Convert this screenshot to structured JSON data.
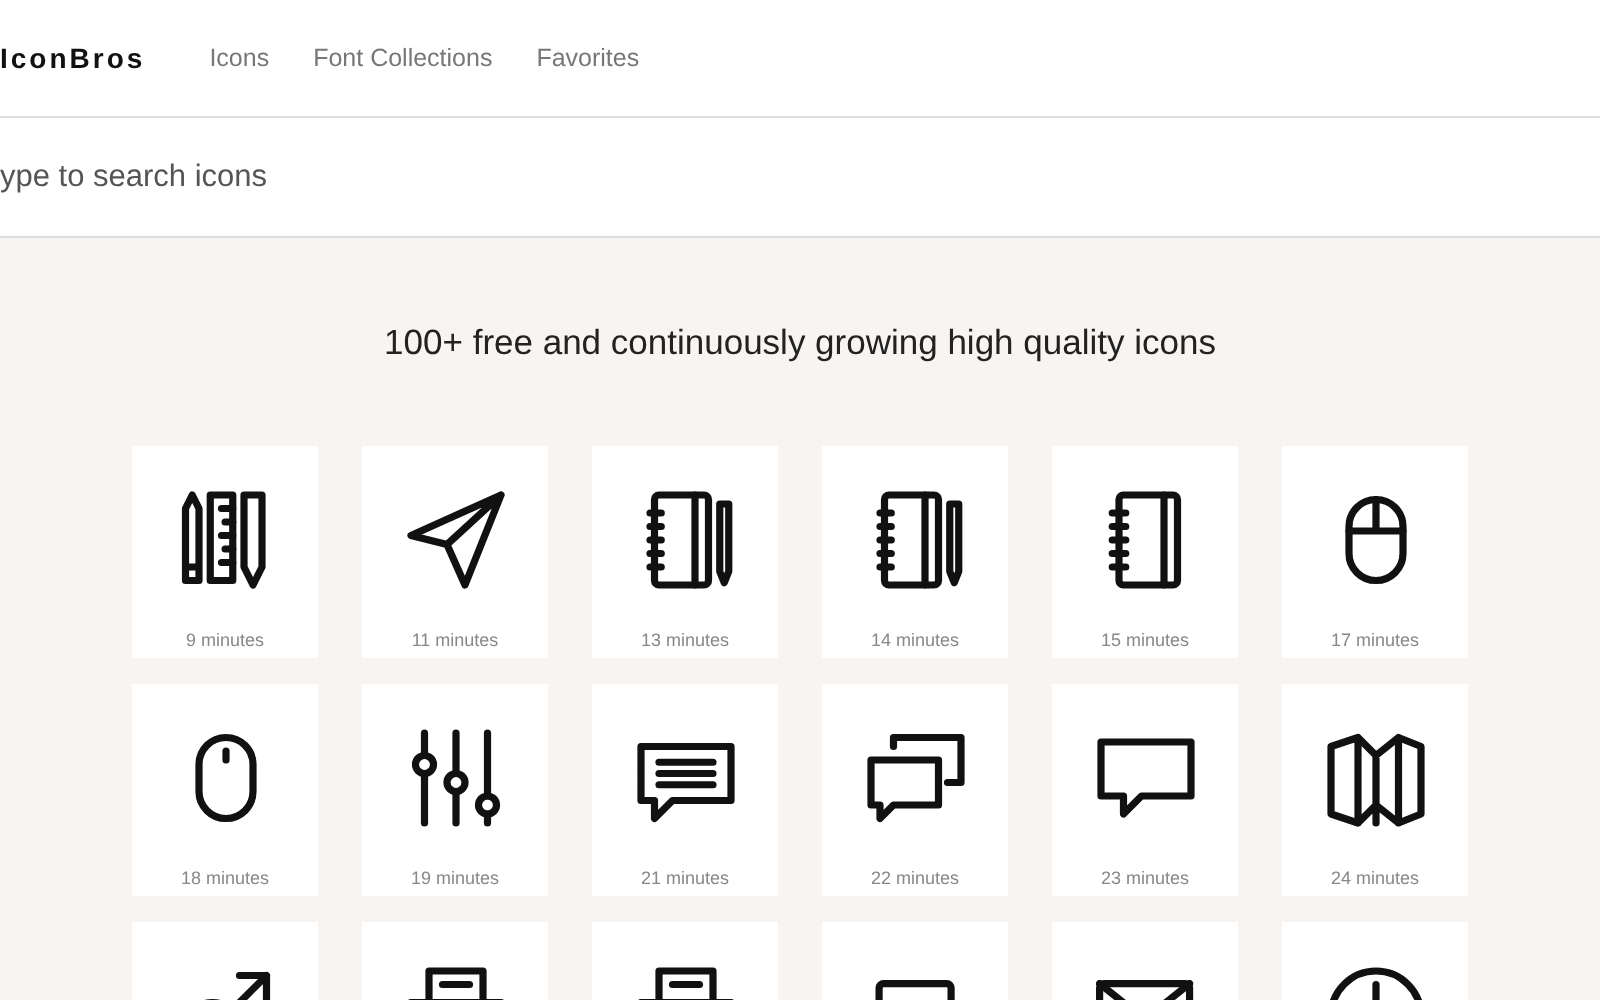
{
  "header": {
    "logo": "IconBros",
    "nav": [
      {
        "label": "Icons"
      },
      {
        "label": "Font Collections"
      },
      {
        "label": "Favorites"
      }
    ]
  },
  "search": {
    "placeholder": "ype to search icons"
  },
  "headline": "100+ free and continuously growing high quality icons",
  "icons": [
    {
      "kind": "stationery",
      "label": "9 minutes"
    },
    {
      "kind": "plane",
      "label": "11 minutes"
    },
    {
      "kind": "notebookpen",
      "label": "13 minutes"
    },
    {
      "kind": "notebookpen",
      "label": "14 minutes"
    },
    {
      "kind": "notebook",
      "label": "15 minutes"
    },
    {
      "kind": "mouse",
      "label": "17 minutes"
    },
    {
      "kind": "mouseplain",
      "label": "18 minutes"
    },
    {
      "kind": "sliders",
      "label": "19 minutes"
    },
    {
      "kind": "message",
      "label": "21 minutes"
    },
    {
      "kind": "chats",
      "label": "22 minutes"
    },
    {
      "kind": "bubble",
      "label": "23 minutes"
    },
    {
      "kind": "map",
      "label": "24 minutes"
    },
    {
      "kind": "male"
    },
    {
      "kind": "printer"
    },
    {
      "kind": "printer"
    },
    {
      "kind": "laptop"
    },
    {
      "kind": "mail"
    },
    {
      "kind": "clock"
    }
  ]
}
